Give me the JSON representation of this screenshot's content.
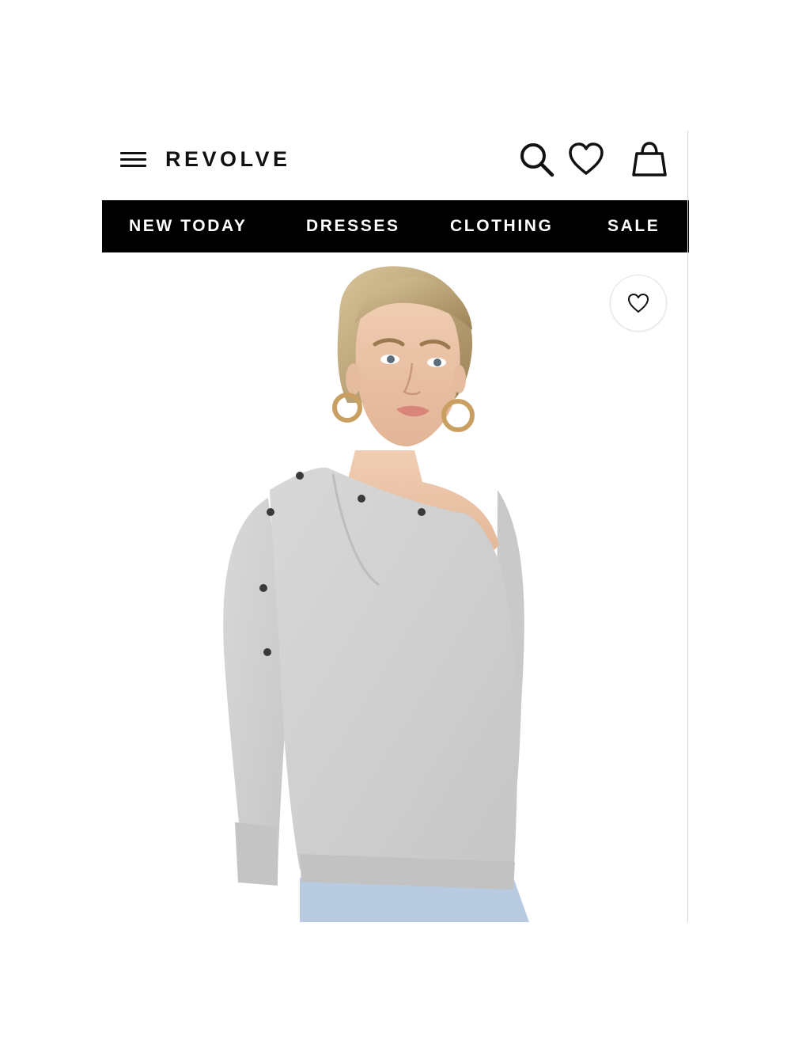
{
  "header": {
    "menu_icon": "hamburger-menu-icon",
    "logo_text": "REVOLVE",
    "icons": [
      "search-icon",
      "heart-icon",
      "shopping-bag-icon"
    ]
  },
  "nav": {
    "items": [
      {
        "label": "NEW TODAY"
      },
      {
        "label": "DRESSES"
      },
      {
        "label": "CLOTHING"
      },
      {
        "label": "SALE"
      }
    ]
  },
  "product": {
    "wishlist_icon": "heart-outline-icon",
    "image_subject": "model wearing grey off-shoulder snap-button sweater",
    "colors": {
      "sweater": "#cfcfcf",
      "navbar": "#000000",
      "background": "#ffffff"
    }
  }
}
